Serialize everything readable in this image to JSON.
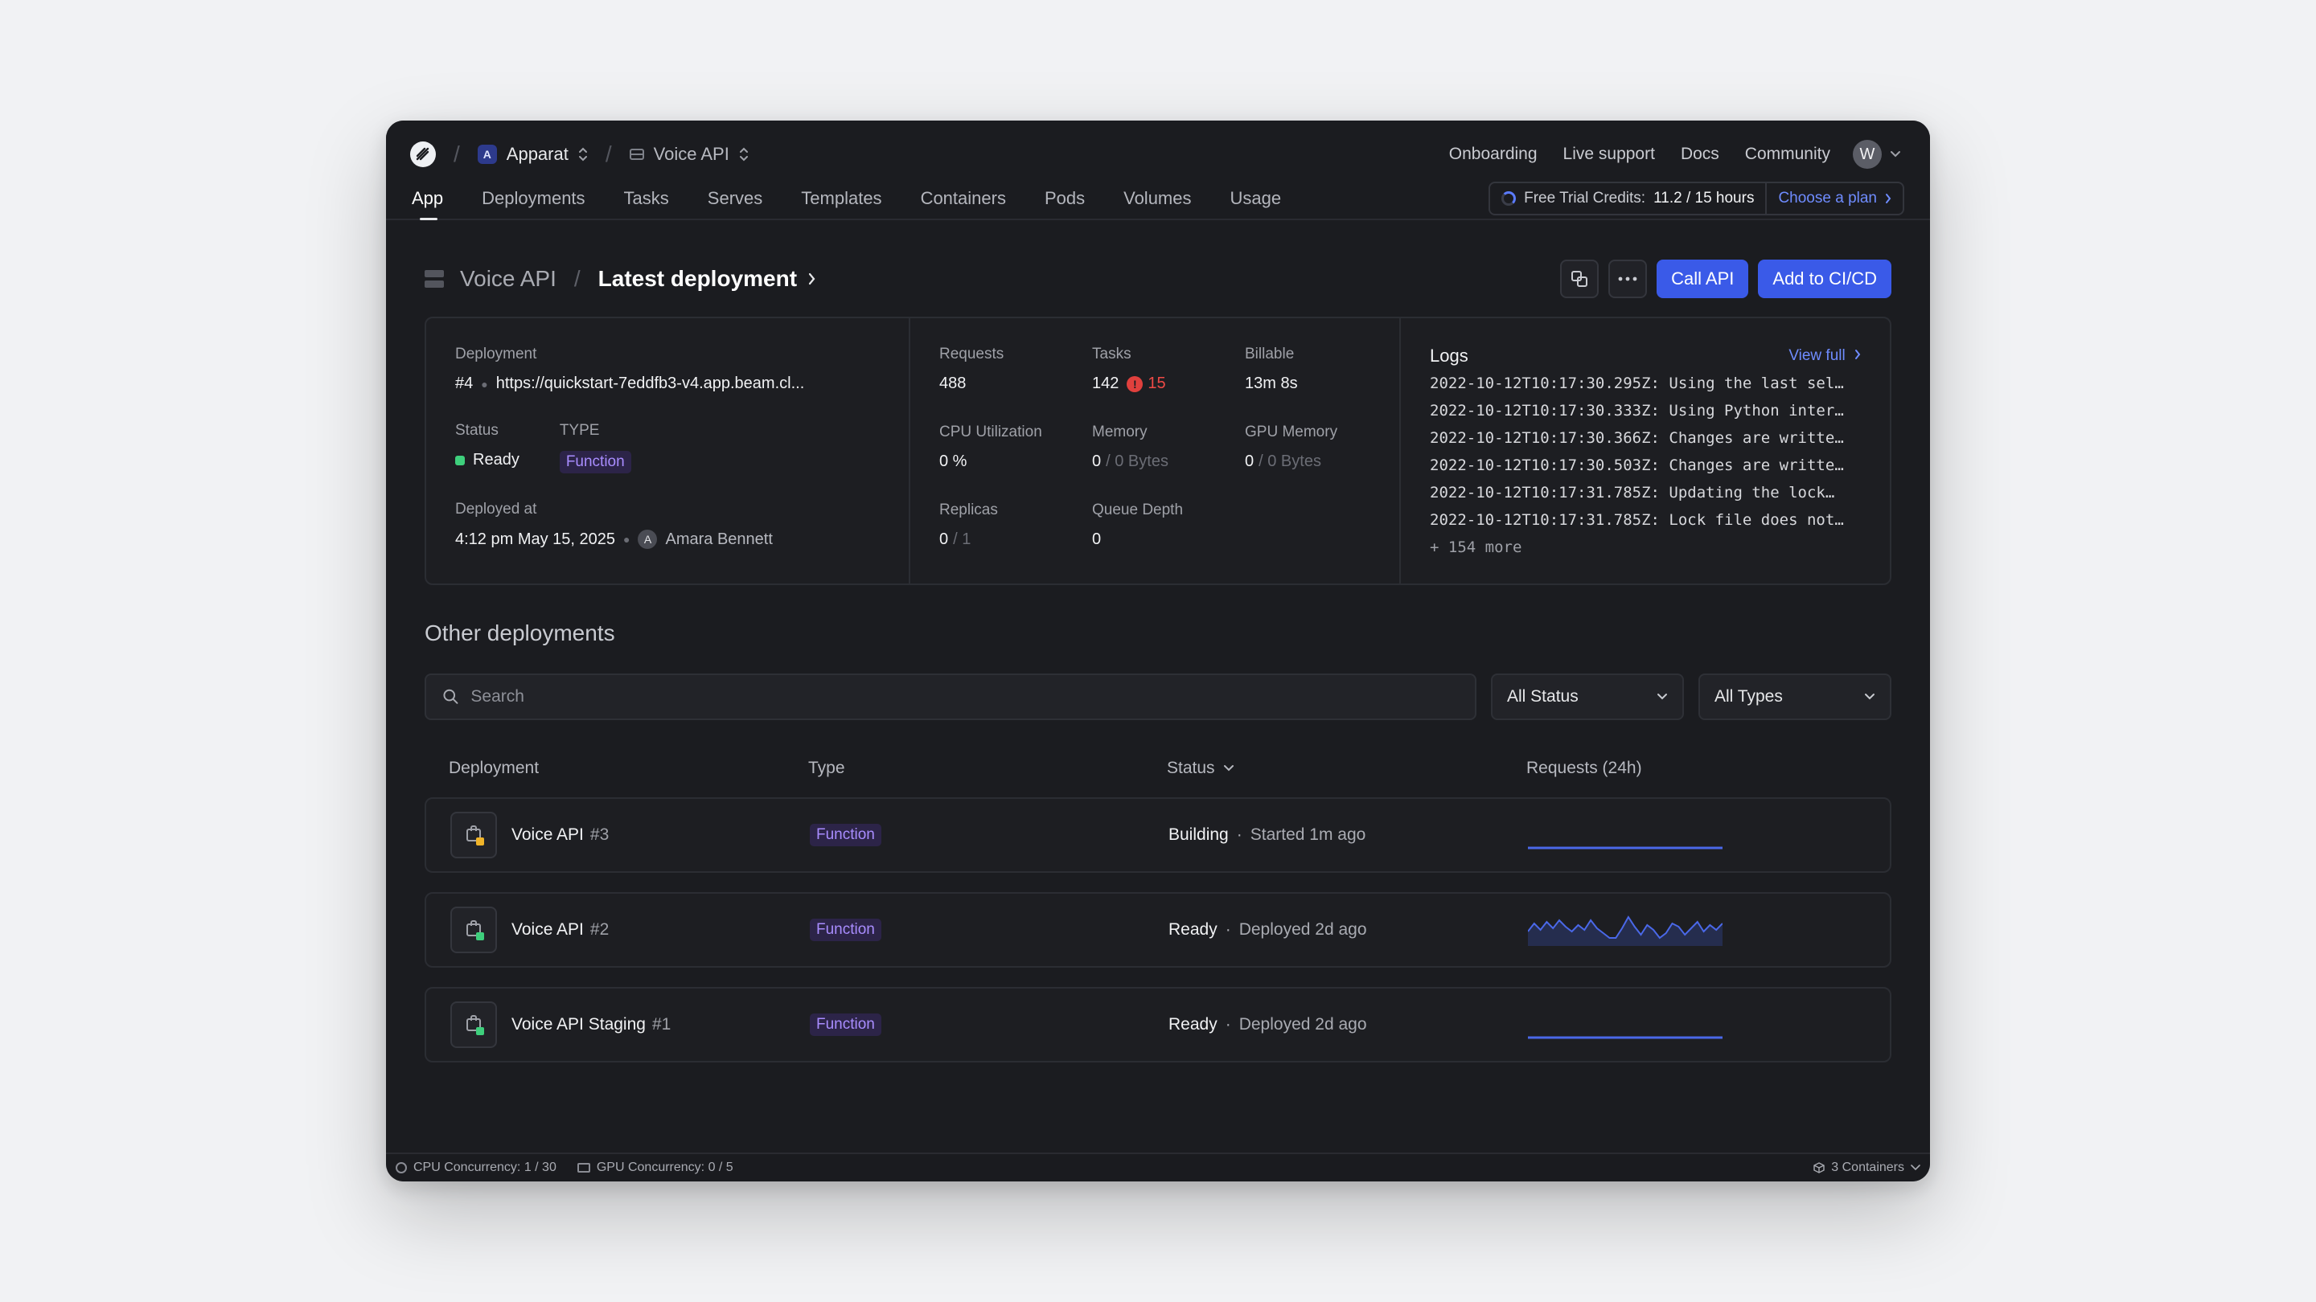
{
  "nav": {
    "workspace": "Apparat",
    "workspace_initial": "A",
    "app": "Voice API",
    "links": [
      "Onboarding",
      "Live support",
      "Docs",
      "Community"
    ],
    "user_initial": "W",
    "tabs": [
      "App",
      "Deployments",
      "Tasks",
      "Serves",
      "Templates",
      "Containers",
      "Pods",
      "Volumes",
      "Usage"
    ],
    "credits_label": "Free Trial Credits:",
    "credits_value": "11.2 / 15 hours",
    "choose_plan": "Choose a plan"
  },
  "header": {
    "app": "Voice API",
    "current": "Latest deployment",
    "call_api": "Call API",
    "add_cicd": "Add to CI/CD"
  },
  "summary": {
    "deployment_label": "Deployment",
    "deployment_num": "#4",
    "deployment_url": "https://quickstart-7eddfb3-v4.app.beam.cl...",
    "status_label": "Status",
    "status_value": "Ready",
    "type_label": "TYPE",
    "type_value": "Function",
    "deployed_label": "Deployed at",
    "deployed_value": "4:12 pm May 15, 2025",
    "author_initial": "A",
    "author": "Amara Bennett",
    "metrics": {
      "requests_label": "Requests",
      "requests": "488",
      "tasks_label": "Tasks",
      "tasks": "142",
      "tasks_failed": "15",
      "billable_label": "Billable",
      "billable": "13m 8s",
      "cpu_label": "CPU Utilization",
      "cpu": "0 %",
      "memory_label": "Memory",
      "memory": "0",
      "memory_total": "/ 0 Bytes",
      "gpu_label": "GPU Memory",
      "gpu": "0",
      "gpu_total": "/ 0 Bytes",
      "replicas_label": "Replicas",
      "replicas": "0",
      "replicas_total": "/ 1",
      "queue_label": "Queue Depth",
      "queue": "0"
    },
    "logs": {
      "title": "Logs",
      "view_full": "View full",
      "lines": [
        "2022-10-12T10:17:30.295Z:  Using the last sel…",
        "2022-10-12T10:17:30.333Z:  Using Python inter…",
        "2022-10-12T10:17:30.366Z:  Changes are writte…",
        "2022-10-12T10:17:30.503Z:  Changes are writte…",
        "2022-10-12T10:17:31.785Z:  Updating the lock…",
        "2022-10-12T10:17:31.785Z:  Lock file does not…"
      ],
      "more": "+ 154 more"
    }
  },
  "other": {
    "title": "Other deployments",
    "search_placeholder": "Search",
    "status_filter": "All Status",
    "type_filter": "All Types",
    "columns": [
      "Deployment",
      "Type",
      "Status",
      "Requests (24h)"
    ],
    "rows": [
      {
        "name": "Voice API",
        "num": "#3",
        "type": "Function",
        "status": "Building",
        "detail": "Started 1m ago",
        "state_color": "#f0b429"
      },
      {
        "name": "Voice API",
        "num": "#2",
        "type": "Function",
        "status": "Ready",
        "detail": "Deployed 2d ago",
        "state_color": "#3ecf7c"
      },
      {
        "name": "Voice API Staging",
        "num": "#1",
        "type": "Function",
        "status": "Ready",
        "detail": "Deployed 2d ago",
        "state_color": "#3ecf7c"
      }
    ]
  },
  "footer": {
    "cpu": "CPU Concurrency: 1 / 30",
    "gpu": "GPU Concurrency: 0 / 5",
    "containers": "3 Containers"
  },
  "colors": {
    "accent": "#3a5ae8",
    "ready": "#3ecf7c",
    "building": "#f0b429",
    "error": "#ef4a46"
  }
}
